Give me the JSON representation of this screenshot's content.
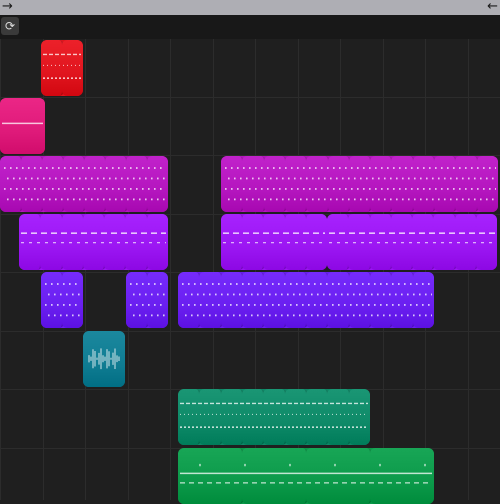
{
  "window": {
    "back_icon": "arrow-right-icon",
    "forward_icon": "arrow-left-icon",
    "back_glyph": "→",
    "forward_glyph": "←"
  },
  "toolbar": {
    "loop_icon": "loop-icon",
    "loop_glyph": "⟳"
  },
  "colors": {
    "background": "#1f1f1f",
    "grid_line": "#2c2c2c",
    "topbar": "#aeaeb4",
    "red": "#e0151e",
    "pink": "#df1a7a",
    "magenta": "#b516bf",
    "purple": "#9b16f2",
    "violet": "#6a1ff0",
    "teal": "#0f7c92",
    "green_teal": "#0e8a68",
    "green": "#0c9a4a"
  },
  "tracks": [
    {
      "name": "track-1-red",
      "color_key": "red",
      "clips": [
        {
          "pattern": "drum",
          "segments": 2
        }
      ]
    },
    {
      "name": "track-2-pink",
      "color_key": "pink",
      "clips": [
        {
          "pattern": "line",
          "segments": 1
        }
      ]
    },
    {
      "name": "track-3-magenta",
      "color_key": "magenta",
      "clips": [
        {
          "pattern": "dots",
          "segments": 8
        },
        {
          "pattern": "dots",
          "segments": 13
        }
      ]
    },
    {
      "name": "track-4-purple",
      "color_key": "purple",
      "clips": [
        {
          "pattern": "dash",
          "segments": 7
        },
        {
          "pattern": "dash",
          "segments": 5
        },
        {
          "pattern": "dash",
          "segments": 8
        }
      ]
    },
    {
      "name": "track-5-violet",
      "color_key": "violet",
      "clips": [
        {
          "pattern": "dots",
          "segments": 2
        },
        {
          "pattern": "dots",
          "segments": 2
        },
        {
          "pattern": "dots",
          "segments": 12
        }
      ]
    },
    {
      "name": "track-6-teal",
      "color_key": "teal",
      "clips": [
        {
          "pattern": "wave",
          "segments": 1
        }
      ]
    },
    {
      "name": "track-7-green-teal",
      "color_key": "green_teal",
      "clips": [
        {
          "pattern": "drum",
          "segments": 9
        }
      ]
    },
    {
      "name": "track-8-green",
      "color_key": "green",
      "clips": [
        {
          "pattern": "line",
          "segments": 4
        }
      ]
    }
  ]
}
